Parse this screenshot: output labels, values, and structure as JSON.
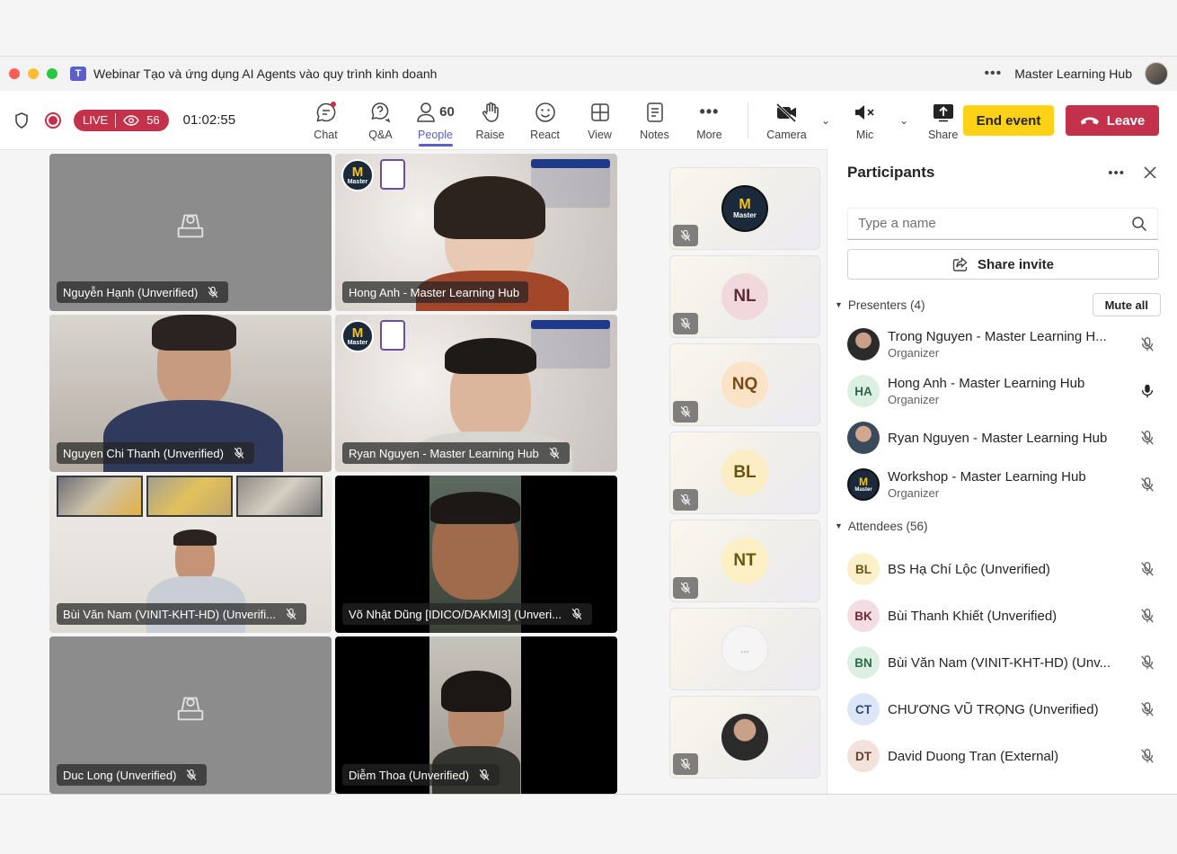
{
  "window": {
    "title": "Webinar Tạo và ứng dụng AI Agents vào quy trình kinh doanh",
    "account_name": "Master Learning Hub"
  },
  "toolbar": {
    "live_label": "LIVE",
    "viewer_count": "56",
    "timer": "01:02:55",
    "tools": {
      "chat": "Chat",
      "qa": "Q&A",
      "people": "People",
      "people_count": "60",
      "raise": "Raise",
      "react": "React",
      "view": "View",
      "notes": "Notes",
      "more": "More",
      "camera": "Camera",
      "mic": "Mic",
      "share": "Share"
    },
    "end_event": "End event",
    "leave": "Leave"
  },
  "grid": [
    {
      "name": "Nguyễn Hạnh (Unverified)"
    },
    {
      "name": "Hong Anh - Master Learning Hub"
    },
    {
      "name": "Nguyen Chi Thanh (Unverified)"
    },
    {
      "name": "Ryan Nguyen - Master Learning Hub"
    },
    {
      "name": "Bùi Văn Nam (VINIT-KHT-HD) (Unverifi..."
    },
    {
      "name": "Võ Nhật Dũng [IDICO/DAKMI3] (Unveri..."
    },
    {
      "name": "Duc Long (Unverified)"
    },
    {
      "name": "Diễm Thoa (Unverified)"
    }
  ],
  "side_tiles": {
    "t2": "NL",
    "t3": "NQ",
    "t4": "BL",
    "t5": "NT",
    "t6": "..."
  },
  "logo": {
    "letter": "M",
    "word": "Master"
  },
  "participants": {
    "title": "Participants",
    "search_placeholder": "Type a name",
    "share_invite": "Share invite",
    "presenters_label": "Presenters (4)",
    "mute_all": "Mute all",
    "attendees_label": "Attendees (56)",
    "presenters": [
      {
        "name": "Trong Nguyen - Master Learning H...",
        "role": "Organizer"
      },
      {
        "name": "Hong Anh - Master Learning Hub",
        "role": "Organizer",
        "initials": "HA"
      },
      {
        "name": "Ryan Nguyen - Master Learning Hub"
      },
      {
        "name": "Workshop - Master Learning Hub",
        "role": "Organizer"
      }
    ],
    "attendees": [
      {
        "initials": "BL",
        "name": "BS Hạ Chí Lộc (Unverified)"
      },
      {
        "initials": "BK",
        "name": "Bùi Thanh Khiết (Unverified)"
      },
      {
        "initials": "BN",
        "name": "Bùi Văn Nam (VINIT-KHT-HD) (Unv..."
      },
      {
        "initials": "CT",
        "name": "CHƯƠNG VŨ TRỌNG (Unverified)"
      },
      {
        "initials": "DT",
        "name": "David Duong Tran (External)"
      }
    ]
  },
  "colors": {
    "accent": "#5b5fc7",
    "live_red": "#c4314b",
    "end_event_yellow": "#fcd116",
    "leave_red": "#c4314b"
  }
}
